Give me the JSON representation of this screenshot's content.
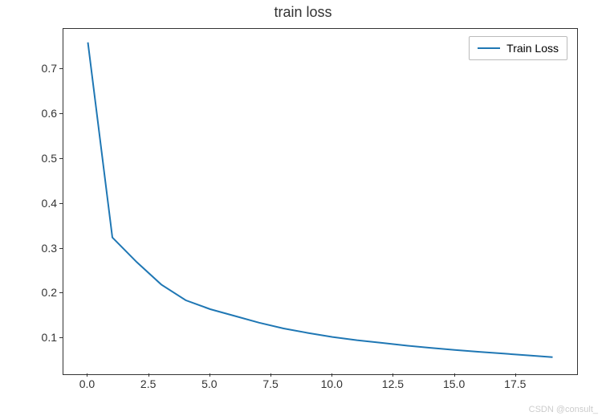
{
  "chart_data": {
    "type": "line",
    "title": "train loss",
    "xlabel": "",
    "ylabel": "",
    "xlim": [
      -1,
      20
    ],
    "ylim": [
      0.02,
      0.79
    ],
    "x_ticks": [
      0.0,
      2.5,
      5.0,
      7.5,
      10.0,
      12.5,
      15.0,
      17.5
    ],
    "x_tick_labels": [
      "0.0",
      "2.5",
      "5.0",
      "7.5",
      "10.0",
      "12.5",
      "15.0",
      "17.5"
    ],
    "y_ticks": [
      0.1,
      0.2,
      0.3,
      0.4,
      0.5,
      0.6,
      0.7
    ],
    "y_tick_labels": [
      "0.1",
      "0.2",
      "0.3",
      "0.4",
      "0.5",
      "0.6",
      "0.7"
    ],
    "series": [
      {
        "name": "Train Loss",
        "color": "#1f77b4",
        "x": [
          0,
          1,
          2,
          3,
          4,
          5,
          6,
          7,
          8,
          9,
          10,
          11,
          12,
          13,
          14,
          15,
          16,
          17,
          18,
          19
        ],
        "values": [
          0.76,
          0.325,
          0.27,
          0.22,
          0.185,
          0.165,
          0.15,
          0.135,
          0.122,
          0.112,
          0.103,
          0.096,
          0.09,
          0.084,
          0.079,
          0.074,
          0.07,
          0.066,
          0.062,
          0.058
        ]
      }
    ],
    "legend_position": "upper right"
  },
  "watermark": "CSDN @consult_"
}
